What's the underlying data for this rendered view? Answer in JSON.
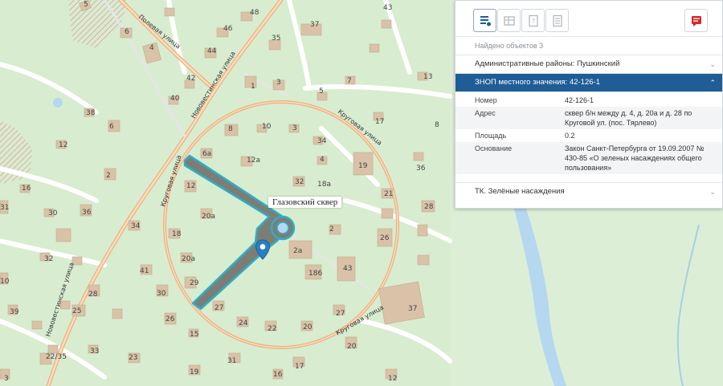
{
  "map": {
    "poi_label": "Глазовский сквер",
    "streets": {
      "poleva": "Полевая улица",
      "novovest_top": "Нововестинская улица",
      "krugovaya_left": "Круговая улица",
      "krugovaya_right": "Круговая улица",
      "novovest_bottom": "Нововестинская улица",
      "krugovaya_bottom": "Круговая улица"
    },
    "building_numbers": [
      "5",
      "48",
      "43",
      "6",
      "46",
      "35",
      "37",
      "4",
      "44",
      "42",
      "1",
      "3",
      "7",
      "40",
      "5",
      "13",
      "38",
      "6",
      "8",
      "10",
      "3",
      "17",
      "8",
      "34",
      "12",
      "4",
      "6a",
      "12a",
      "19",
      "36",
      "2",
      "12",
      "32",
      "16",
      "21",
      "28",
      "30",
      "36",
      "20a",
      "2a",
      "31",
      "34",
      "18",
      "26",
      "32",
      "20a",
      "186",
      "43",
      "41",
      "30",
      "29",
      "28",
      "27",
      "25",
      "39",
      "26",
      "24",
      "22",
      "20",
      "27",
      "37",
      "15",
      "22/35",
      "31",
      "20",
      "19",
      "33",
      "17",
      "3",
      "12",
      "18a",
      "2",
      "10",
      "16",
      "23"
    ],
    "colors": {
      "land": "#d8ecd0",
      "road_major": "#f6c89a",
      "road_minor": "#ffffff",
      "building": "#d9c2a8",
      "water": "#b5d8f0",
      "selected_fill": "#7d7d78",
      "selected_outline": "#2ab0c6"
    }
  },
  "panel": {
    "found": "Найдено объектов 3",
    "sections": [
      {
        "label": "Административные районы: Пушкинский"
      },
      {
        "label": "ЗНОП местного значения: 42-126-1"
      },
      {
        "label": "ТК. Зелёные насаждения"
      }
    ],
    "details": [
      {
        "label": "Номер",
        "value": "42-126-1"
      },
      {
        "label": "Адрес",
        "value": "сквер б/н между д. 4, д. 20а и д. 28 по Круговой ул. (пос. Тярлево)"
      },
      {
        "label": "Площадь",
        "value": "0.2"
      },
      {
        "label": "Основание",
        "value": "Закон Санкт-Петербурга от 19.09.2007 № 430-85 «О зеленых насаждениях общего пользования»"
      }
    ],
    "tools": [
      "list-details-icon",
      "layers-table-icon",
      "question-doc-icon",
      "document-icon",
      "report-icon"
    ],
    "accent": "#1f5d96",
    "report_color": "#d8262b"
  }
}
